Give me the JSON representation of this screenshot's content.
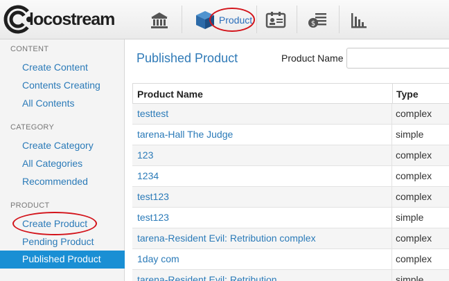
{
  "brand": {
    "logo_text": "locostream"
  },
  "nav": {
    "items": [
      {
        "icon": "bank-icon"
      },
      {
        "icon": "cube-icon",
        "label": "Product"
      },
      {
        "icon": "contact-card-icon"
      },
      {
        "icon": "billing-icon"
      },
      {
        "icon": "bar-chart-icon"
      }
    ]
  },
  "sidebar": {
    "sections": [
      {
        "heading": "CONTENT",
        "items": [
          "Create Content",
          "Contents Creating",
          "All Contents"
        ]
      },
      {
        "heading": "CATEGORY",
        "items": [
          "Create Category",
          "All Categories",
          "Recommended"
        ]
      },
      {
        "heading": "PRODUCT",
        "items": [
          "Create Product",
          "Pending Product",
          "Published Product"
        ]
      }
    ],
    "active_item": "Published Product"
  },
  "main": {
    "title": "Published Product",
    "filter": {
      "label": "Product Name",
      "value": ""
    },
    "table": {
      "columns": [
        "Product Name",
        "Type"
      ],
      "rows": [
        {
          "name": "testtest",
          "type": "complex"
        },
        {
          "name": "tarena-Hall The Judge",
          "type": "simple"
        },
        {
          "name": "123",
          "type": "complex"
        },
        {
          "name": "1234",
          "type": "complex"
        },
        {
          "name": "test123",
          "type": "complex"
        },
        {
          "name": "test123",
          "type": "simple"
        },
        {
          "name": "tarena-Resident Evil: Retribution complex",
          "type": "complex"
        },
        {
          "name": "1day com",
          "type": "complex"
        },
        {
          "name": "tarena-Resident Evil: Retribution",
          "type": "simple"
        }
      ]
    }
  },
  "colors": {
    "accent": "#1a8fd4",
    "link": "#2a7ab8",
    "annotation": "#d3131a"
  }
}
